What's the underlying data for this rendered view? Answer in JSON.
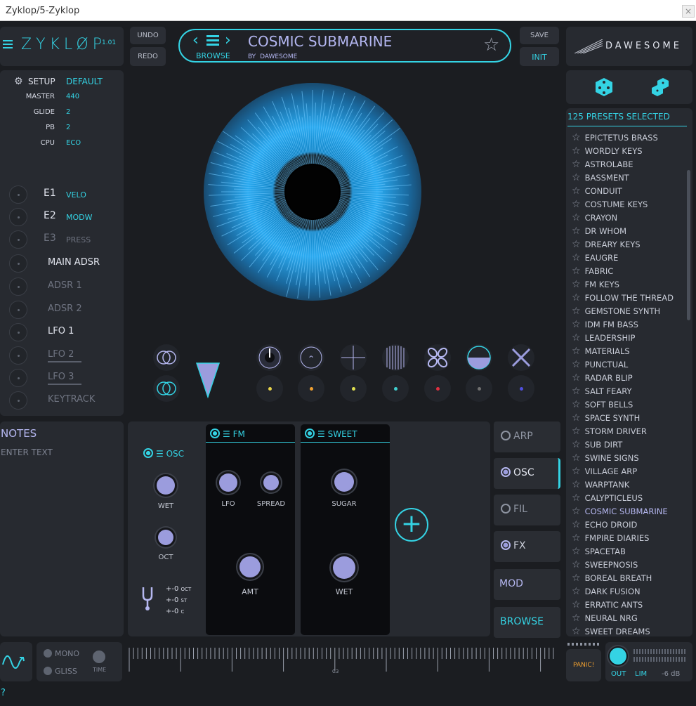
{
  "window": {
    "title": "Zyklop/5-Zyklop",
    "close": "×"
  },
  "logo": {
    "name": "ZYKLØP",
    "version": "1.01"
  },
  "history": {
    "undo": "UNDO",
    "redo": "REDO"
  },
  "preset_bar": {
    "name": "COSMIC SUBMARINE",
    "browse": "BROWSE",
    "by": "BY",
    "author": "DAWESOME"
  },
  "file": {
    "save": "SAVE",
    "init": "INIT"
  },
  "brand": "DAWESOME",
  "setup": {
    "title": "SETUP",
    "value": "DEFAULT",
    "rows": [
      {
        "label": "MASTER",
        "value": "440"
      },
      {
        "label": "GLIDE",
        "value": "2"
      },
      {
        "label": "PB",
        "value": "2"
      },
      {
        "label": "CPU",
        "value": "ECO"
      }
    ]
  },
  "modulators": [
    {
      "label": "E1",
      "value": "VELO"
    },
    {
      "label": "E2",
      "value": "MODW"
    },
    {
      "label": "E3",
      "value": "PRESS"
    },
    {
      "label": "MAIN ADSR",
      "value": ""
    },
    {
      "label": "ADSR 1",
      "value": ""
    },
    {
      "label": "ADSR 2",
      "value": ""
    },
    {
      "label": "LFO 1",
      "value": ""
    },
    {
      "label": "LFO 2",
      "value": ""
    },
    {
      "label": "LFO 3",
      "value": ""
    },
    {
      "label": "KEYTRACK",
      "value": ""
    }
  ],
  "notes": {
    "title": "NOTES",
    "placeholder": "ENTER TEXT"
  },
  "presets": {
    "count_label": "125 PRESETS SELECTED",
    "items": [
      "EPICTETUS BRASS",
      "WORDLY KEYS",
      "ASTROLABE",
      "BASSMENT",
      "CONDUIT",
      "COSTUME KEYS",
      "CRAYON",
      "DR WHOM",
      "DREARY KEYS",
      "EAUGRE",
      "FABRIC",
      "FM KEYS",
      "FOLLOW THE THREAD",
      "GEMSTONE SYNTH",
      "IDM FM BASS",
      "LEADERSHIP",
      "MATERIALS",
      "PUNCTUAL",
      "RADAR BLIP",
      "SALT FEARY",
      "SOFT BELLS",
      "SPACE SYNTH",
      "STORM DRIVER",
      "SUB DIRT",
      "SWINE SIGNS",
      "VILLAGE ARP",
      "WARPTANK",
      "CALYPTICLEUS",
      "COSMIC SUBMARINE",
      "ECHO DROID",
      "FMPIRE DIARIES",
      "SPACETAB",
      "SWEEPNOSIS",
      "BOREAL BREATH",
      "DARK FUSION",
      "ERRATIC ANTS",
      "NEURAL NRG",
      "SWEET DREAMS"
    ],
    "selected": "COSMIC SUBMARINE"
  },
  "osc": {
    "title": "OSC",
    "wet": "WET",
    "oct": "OCT",
    "tune": [
      "+-0",
      "+-0",
      "+-0"
    ],
    "tune_units": [
      "OCT",
      "ST",
      "C"
    ]
  },
  "fm": {
    "title": "FM",
    "lfo": "LFO",
    "spread": "SPREAD",
    "amt": "AMT"
  },
  "sweet": {
    "title": "SWEET",
    "sugar": "SUGAR",
    "wet": "WET"
  },
  "tabs": [
    "ARP",
    "OSC",
    "FIL",
    "FX",
    "MOD",
    "BROWSE"
  ],
  "voice": {
    "mono": "MONO",
    "gliss": "GLISS",
    "time": "TIME"
  },
  "keyboard": {
    "c3": "C3"
  },
  "output": {
    "panic": "PANIC!",
    "out": "OUT",
    "lim": "LIM",
    "db": "-6 dB"
  },
  "help": "?",
  "dot_colors": [
    "#e8d44a",
    "#f0a030",
    "#e0e050",
    "#40d0d0",
    "#e03040",
    "#707070",
    "#5050e0"
  ]
}
